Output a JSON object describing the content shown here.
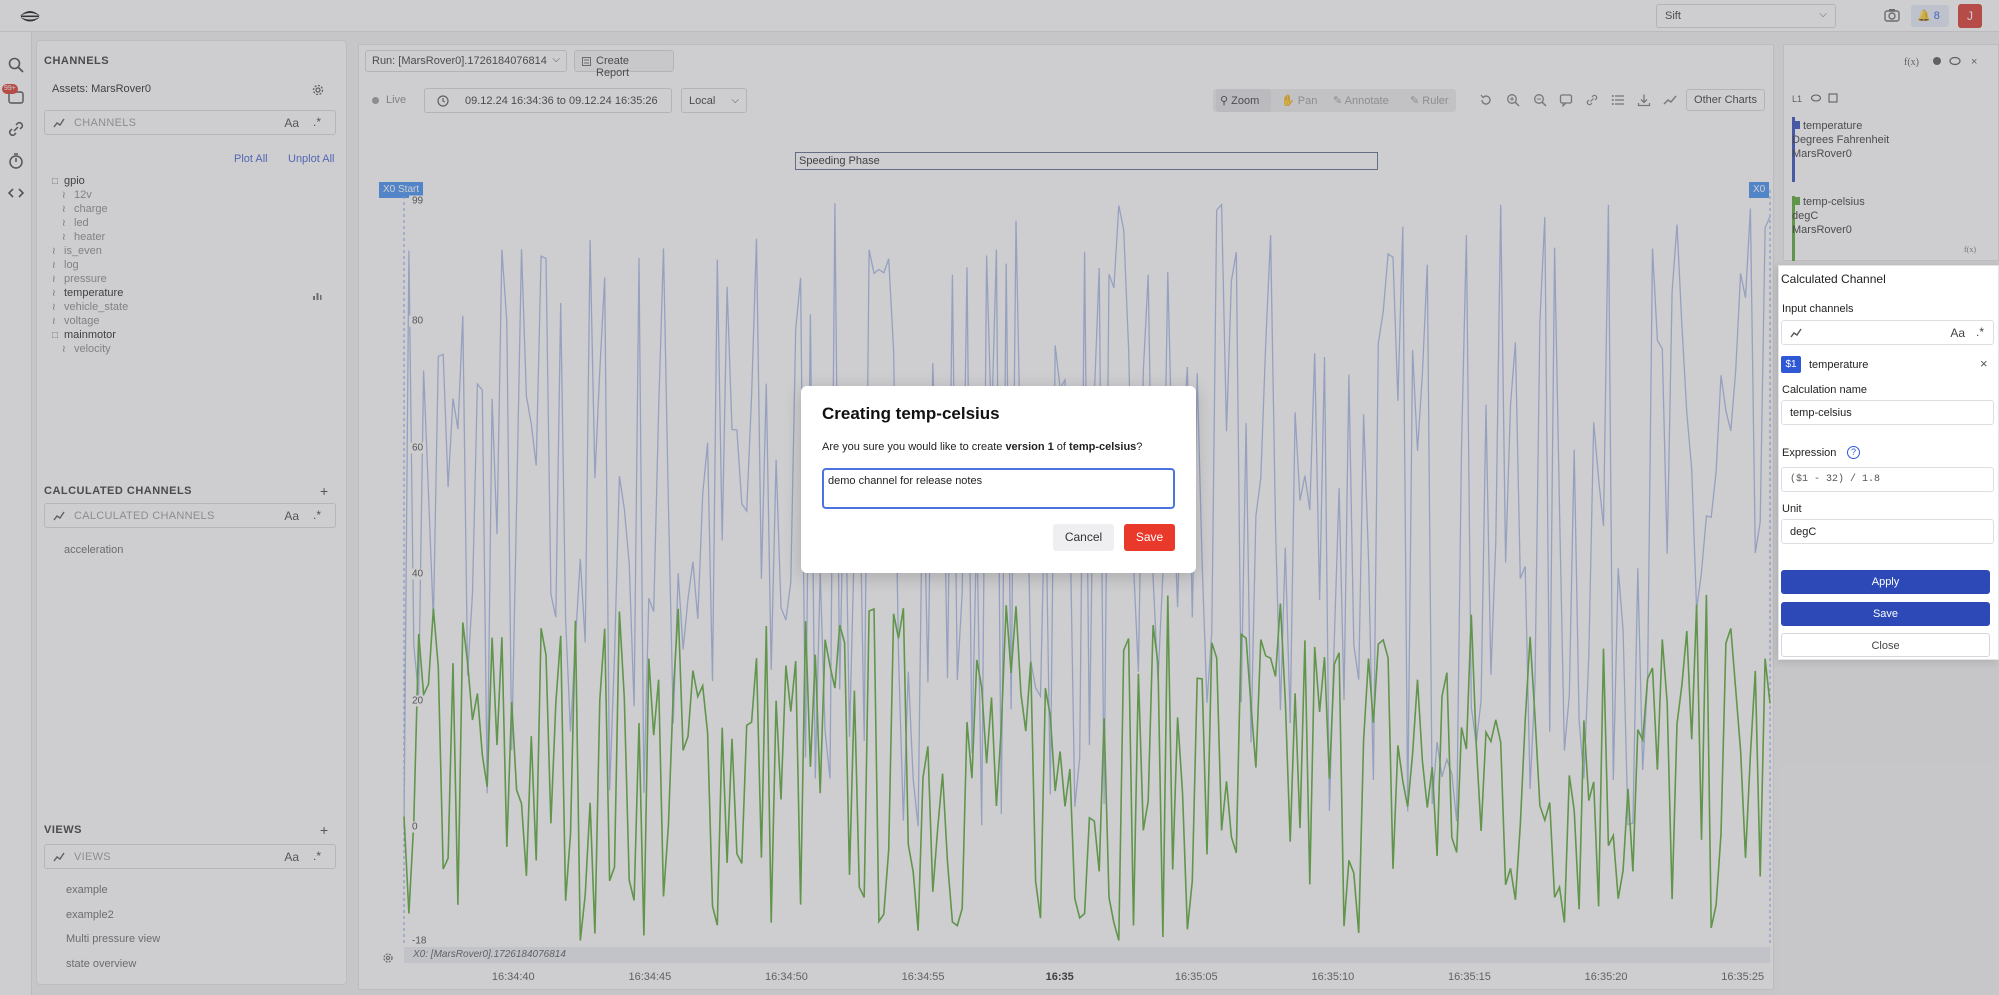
{
  "topbar": {
    "workspace": "Sift",
    "notifications": "8",
    "user_initial": "J"
  },
  "rail": {
    "badge": "99+"
  },
  "channels": {
    "title": "CHANNELS",
    "assets": "Assets: MarsRover0",
    "search_placeholder": "CHANNELS",
    "case_toggle": "Aa",
    "regex_toggle": ".*",
    "plot_all": "Plot All",
    "unplot_all": "Unplot All",
    "tree": [
      {
        "label": "gpio",
        "kind": "folder",
        "depth": 0
      },
      {
        "label": "12v",
        "kind": "channel",
        "depth": 1
      },
      {
        "label": "charge",
        "kind": "channel",
        "depth": 1
      },
      {
        "label": "led",
        "kind": "channel",
        "depth": 1
      },
      {
        "label": "heater",
        "kind": "channel",
        "depth": 1
      },
      {
        "label": "is_even",
        "kind": "channel",
        "depth": 0
      },
      {
        "label": "log",
        "kind": "channel",
        "depth": 0
      },
      {
        "label": "pressure",
        "kind": "channel",
        "depth": 0
      },
      {
        "label": "temperature",
        "kind": "channel",
        "depth": 0,
        "active": true
      },
      {
        "label": "vehicle_state",
        "kind": "channel",
        "depth": 0
      },
      {
        "label": "voltage",
        "kind": "channel",
        "depth": 0
      },
      {
        "label": "mainmotor",
        "kind": "folder",
        "depth": 0
      },
      {
        "label": "velocity",
        "kind": "channel",
        "depth": 1
      }
    ]
  },
  "calculated": {
    "title": "CALCULATED CHANNELS",
    "search_placeholder": "CALCULATED CHANNELS",
    "case_toggle": "Aa",
    "regex_toggle": ".*",
    "items": [
      "acceleration"
    ]
  },
  "views": {
    "title": "VIEWS",
    "search_placeholder": "VIEWS",
    "case_toggle": "Aa",
    "regex_toggle": ".*",
    "items": [
      "example",
      "example2",
      "Multi pressure view",
      "state overview"
    ]
  },
  "toolbar": {
    "run": "Run: [MarsRover0].1726184076814",
    "create_report": "Create Report",
    "live": "Live",
    "time_range": "09.12.24 16:34:36 to 09.12.24 16:35:26",
    "timezone": "Local",
    "zoom": "Zoom",
    "pan": "Pan",
    "annotate": "Annotate",
    "ruler": "Ruler",
    "other_charts": "Other Charts"
  },
  "chart": {
    "phase_label": "Speeding Phase",
    "x0_start": "X0 Start",
    "x0_end": "X0",
    "footer": "X0: [MarsRover0].1726184076814",
    "y_ticks": [
      "99",
      "80",
      "60",
      "40",
      "20",
      "0",
      "-18"
    ],
    "x_ticks": [
      "16:34:40",
      "16:34:45",
      "16:34:50",
      "16:34:55",
      "16:35",
      "16:35:05",
      "16:35:10",
      "16:35:15",
      "16:35:20",
      "16:35:25"
    ]
  },
  "chart_data": {
    "type": "line",
    "x_range": [
      "16:34:36",
      "16:35:26"
    ],
    "ylim": [
      -18,
      99
    ],
    "y_ticks": [
      99,
      80,
      60,
      40,
      20,
      0,
      -18
    ],
    "x_ticks": [
      "16:34:40",
      "16:34:45",
      "16:34:50",
      "16:34:55",
      "16:35",
      "16:35:05",
      "16:35:10",
      "16:35:15",
      "16:35:20",
      "16:35:25"
    ],
    "grid": false,
    "legend": "right-panel",
    "series": [
      {
        "name": "temperature",
        "unit": "Degrees Fahrenheit",
        "asset": "MarsRover0",
        "color": "#a8b9e6",
        "approx_range": [
          0,
          99
        ],
        "mean": 61
      },
      {
        "name": "temp-celsius",
        "unit": "degC",
        "asset": "MarsRover0",
        "color": "#55a630",
        "approx_range": [
          -18,
          37
        ],
        "mean": 16
      }
    ]
  },
  "legend": [
    {
      "name": "temperature",
      "unit": "Degrees Fahrenheit",
      "asset": "MarsRover0",
      "color": "#2d49b8"
    },
    {
      "name": "temp-celsius",
      "unit": "degC",
      "asset": "MarsRover0",
      "color": "#55a630"
    }
  ],
  "legend_panel": {
    "axis_label": "L1"
  },
  "calc_panel": {
    "title": "Calculated Channel",
    "input_label": "Input channels",
    "case_toggle": "Aa",
    "regex_toggle": ".*",
    "input_tag": "$1",
    "input_channel": "temperature",
    "name_label": "Calculation name",
    "name_value": "temp-celsius",
    "expr_label": "Expression",
    "expr_value": "($1 - 32) / 1.8",
    "unit_label": "Unit",
    "unit_value": "degC",
    "apply": "Apply",
    "save": "Save",
    "close": "Close"
  },
  "modal": {
    "title": "Creating temp-celsius",
    "q_pre": "Are you sure you would like to create ",
    "q_version": "version 1",
    "q_mid": " of ",
    "q_name": "temp-celsius",
    "q_post": "?",
    "note": "demo channel for release notes",
    "cancel": "Cancel",
    "save": "Save"
  }
}
